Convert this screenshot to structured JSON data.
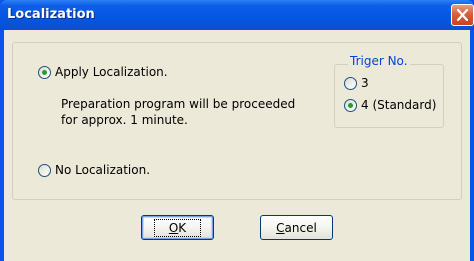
{
  "window": {
    "title": "Localization",
    "close_icon": "close-icon"
  },
  "options": {
    "apply": {
      "label": "Apply Localization.",
      "checked": true
    },
    "description": "Preparation program will be proceeded\nfor approx. 1 minute.",
    "no": {
      "label": "No Localization.",
      "checked": false
    }
  },
  "trigger": {
    "title": "Triger No.",
    "options": [
      {
        "label": "3",
        "checked": false
      },
      {
        "label": "4 (Standard)",
        "checked": true
      }
    ]
  },
  "buttons": {
    "ok": {
      "mnemonic": "O",
      "rest": "K"
    },
    "cancel": {
      "mnemonic": "C",
      "rest": "ancel"
    }
  },
  "colors": {
    "title_bar": "#0457e4",
    "dialog_face": "#ece9d8",
    "close_button": "#d7603a",
    "radio_dot": "#21a121",
    "group_title": "#0046d5"
  }
}
